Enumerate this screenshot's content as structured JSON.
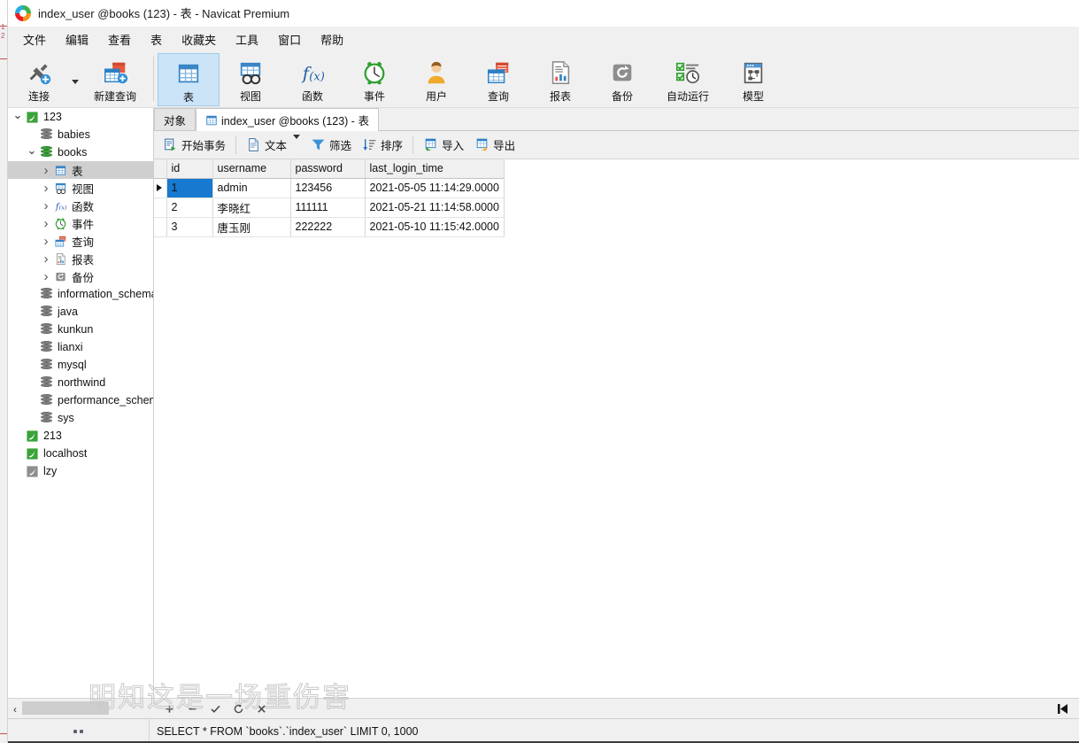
{
  "window": {
    "title": "index_user @books (123) - 表 - Navicat Premium",
    "logo_icon": "navicat-logo-icon"
  },
  "menubar": {
    "items": [
      {
        "label": "文件",
        "name": "menu-file"
      },
      {
        "label": "编辑",
        "name": "menu-edit"
      },
      {
        "label": "查看",
        "name": "menu-view"
      },
      {
        "label": "表",
        "name": "menu-table"
      },
      {
        "label": "收藏夹",
        "name": "menu-favorites"
      },
      {
        "label": "工具",
        "name": "menu-tools"
      },
      {
        "label": "窗口",
        "name": "menu-window"
      },
      {
        "label": "帮助",
        "name": "menu-help"
      }
    ]
  },
  "toolbar": {
    "buttons": [
      {
        "label": "连接",
        "icon": "connection-icon",
        "selected": false,
        "has_caret": true
      },
      {
        "label": "新建查询",
        "icon": "new-query-icon",
        "selected": false,
        "has_caret": false
      },
      {
        "label": "表",
        "icon": "table-icon",
        "selected": true,
        "has_caret": false
      },
      {
        "label": "视图",
        "icon": "view-icon",
        "selected": false,
        "has_caret": false
      },
      {
        "label": "函数",
        "icon": "function-icon",
        "selected": false,
        "has_caret": false
      },
      {
        "label": "事件",
        "icon": "event-icon",
        "selected": false,
        "has_caret": false
      },
      {
        "label": "用户",
        "icon": "user-icon",
        "selected": false,
        "has_caret": false
      },
      {
        "label": "查询",
        "icon": "query-icon",
        "selected": false,
        "has_caret": false
      },
      {
        "label": "报表",
        "icon": "report-icon",
        "selected": false,
        "has_caret": false
      },
      {
        "label": "备份",
        "icon": "backup-icon",
        "selected": false,
        "has_caret": false
      },
      {
        "label": "自动运行",
        "icon": "automation-icon",
        "selected": false,
        "has_caret": false
      },
      {
        "label": "模型",
        "icon": "model-icon",
        "selected": false,
        "has_caret": false
      }
    ]
  },
  "sidebar": {
    "items": [
      {
        "label": "123",
        "icon": "mysql-connection-icon",
        "indent": 0,
        "twisty": "down",
        "selected": false
      },
      {
        "label": "babies",
        "icon": "database-icon",
        "indent": 1,
        "twisty": "none",
        "selected": false
      },
      {
        "label": "books",
        "icon": "database-open-icon",
        "indent": 1,
        "twisty": "down",
        "selected": false
      },
      {
        "label": "表",
        "icon": "table-icon",
        "indent": 2,
        "twisty": "right",
        "selected": true
      },
      {
        "label": "视图",
        "icon": "view-icon",
        "indent": 2,
        "twisty": "right",
        "selected": false
      },
      {
        "label": "函数",
        "icon": "function-icon",
        "indent": 2,
        "twisty": "right",
        "selected": false
      },
      {
        "label": "事件",
        "icon": "event-icon",
        "indent": 2,
        "twisty": "right",
        "selected": false
      },
      {
        "label": "查询",
        "icon": "query-icon",
        "indent": 2,
        "twisty": "right",
        "selected": false
      },
      {
        "label": "报表",
        "icon": "report-icon",
        "indent": 2,
        "twisty": "right",
        "selected": false
      },
      {
        "label": "备份",
        "icon": "backup-icon",
        "indent": 2,
        "twisty": "right",
        "selected": false
      },
      {
        "label": "information_schema",
        "icon": "database-icon",
        "indent": 1,
        "twisty": "none",
        "selected": false
      },
      {
        "label": "java",
        "icon": "database-icon",
        "indent": 1,
        "twisty": "none",
        "selected": false
      },
      {
        "label": "kunkun",
        "icon": "database-icon",
        "indent": 1,
        "twisty": "none",
        "selected": false
      },
      {
        "label": "lianxi",
        "icon": "database-icon",
        "indent": 1,
        "twisty": "none",
        "selected": false
      },
      {
        "label": "mysql",
        "icon": "database-icon",
        "indent": 1,
        "twisty": "none",
        "selected": false
      },
      {
        "label": "northwind",
        "icon": "database-icon",
        "indent": 1,
        "twisty": "none",
        "selected": false
      },
      {
        "label": "performance_schema",
        "icon": "database-icon",
        "indent": 1,
        "twisty": "none",
        "selected": false
      },
      {
        "label": "sys",
        "icon": "database-icon",
        "indent": 1,
        "twisty": "none",
        "selected": false
      },
      {
        "label": "213",
        "icon": "mysql-connection-icon",
        "indent": 0,
        "twisty": "none",
        "selected": false
      },
      {
        "label": "localhost",
        "icon": "mysql-connection-icon",
        "indent": 0,
        "twisty": "none",
        "selected": false
      },
      {
        "label": "lzy",
        "icon": "mariadb-connection-icon",
        "indent": 0,
        "twisty": "none",
        "selected": false
      }
    ]
  },
  "tabs": [
    {
      "label": "对象",
      "icon": "none",
      "active": false
    },
    {
      "label": "index_user @books (123) - 表",
      "icon": "table-icon",
      "active": true
    }
  ],
  "gridbar": {
    "buttons": [
      {
        "label": "开始事务",
        "icon": "begin-transaction-icon",
        "caret": false
      },
      {
        "label": "文本",
        "icon": "text-icon",
        "caret": true
      },
      {
        "label": "筛选",
        "icon": "filter-icon",
        "caret": false
      },
      {
        "label": "排序",
        "icon": "sort-icon",
        "caret": false
      },
      {
        "label": "导入",
        "icon": "import-icon",
        "caret": false
      },
      {
        "label": "导出",
        "icon": "export-icon",
        "caret": false
      }
    ]
  },
  "grid": {
    "columns": [
      "id",
      "username",
      "password",
      "last_login_time"
    ],
    "rows": [
      {
        "current": true,
        "id": "1",
        "username": "admin",
        "password": "123456",
        "last_login_time": "2021-05-05 11:14:29.0000"
      },
      {
        "current": false,
        "id": "2",
        "username": "李晓红",
        "password": "111111",
        "last_login_time": "2021-05-21 11:14:58.0000"
      },
      {
        "current": false,
        "id": "3",
        "username": "唐玉刚",
        "password": "222222",
        "last_login_time": "2021-05-10 11:15:42.0000"
      }
    ]
  },
  "navbar": {
    "icons": [
      "add-record-icon",
      "remove-record-icon",
      "apply-changes-icon",
      "refresh-icon",
      "stop-icon"
    ],
    "last_record_icon": "last-record-icon"
  },
  "statusbar": {
    "grip_icon": "resize-grip-icon",
    "sql": "SELECT * FROM `books`.`index_user` LIMIT 0, 1000"
  },
  "watermark": {
    "text": "明知这是一场重伤害"
  },
  "colors": {
    "accent_selection": "#1779cf",
    "toolbar_selected_bg": "#cce4f7",
    "chrome_bg": "#f0f0f0",
    "tree_selected_bg": "#cfcfcf"
  }
}
